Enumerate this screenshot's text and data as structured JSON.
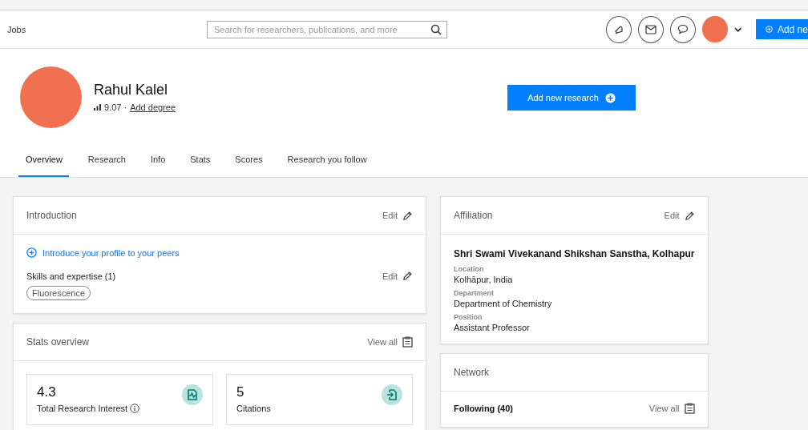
{
  "header": {
    "nav_link": "Jobs",
    "search": {
      "placeholder": "Search for researchers, publications, and more"
    },
    "add_button": "Add ne"
  },
  "profile": {
    "name": "Rahul Kalel",
    "score": "9.07 ·",
    "add_degree": "Add degree",
    "add_research_button": "Add new research"
  },
  "tabs": [
    {
      "label": "Overview",
      "selected": true
    },
    {
      "label": "Research",
      "selected": false
    },
    {
      "label": "Info",
      "selected": false
    },
    {
      "label": "Stats",
      "selected": false
    },
    {
      "label": "Scores",
      "selected": false
    },
    {
      "label": "Research you follow",
      "selected": false
    }
  ],
  "introduction": {
    "title": "Introduction",
    "edit": "Edit",
    "introduce_link": "Introduce your profile to your peers",
    "skills_title": "Skills and expertise (1)",
    "skills_edit": "Edit",
    "skills": [
      "Fluorescence"
    ]
  },
  "stats_overview": {
    "title": "Stats overview",
    "view_all": "View all",
    "stats": [
      {
        "kind": "interest",
        "value": "4.3",
        "label": "Total Research Interest"
      },
      {
        "kind": "citations",
        "value": "5",
        "label": "Citations"
      }
    ]
  },
  "affiliation": {
    "title": "Affiliation",
    "edit": "Edit",
    "institution": "Shri Swami Vivekanand Shikshan Sanstha, Kolhapur",
    "fields": [
      {
        "label": "Location",
        "value": "Kolhāpur, India"
      },
      {
        "label": "Department",
        "value": "Department of Chemistry"
      },
      {
        "label": "Position",
        "value": "Assistant Professor"
      }
    ]
  },
  "network": {
    "title": "Network",
    "following": "Following (40)",
    "view_all": "View all"
  }
}
